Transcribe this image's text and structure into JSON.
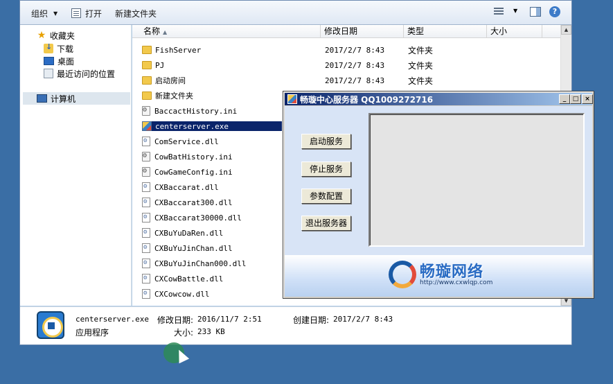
{
  "toolbar": {
    "organize": "组织",
    "open": "打开",
    "new_folder": "新建文件夹"
  },
  "nav": {
    "favorites": "收藏夹",
    "downloads": "下载",
    "desktop": "桌面",
    "recent": "最近访问的位置",
    "computer": "计算机"
  },
  "columns": {
    "name": "名称",
    "modified": "修改日期",
    "type": "类型",
    "size": "大小"
  },
  "files": [
    {
      "name": "FishServer",
      "date": "2017/2/7 8:43",
      "type": "文件夹",
      "icon": "folder-icon"
    },
    {
      "name": "PJ",
      "date": "2017/2/7 8:43",
      "type": "文件夹",
      "icon": "folder-icon"
    },
    {
      "name": "启动房间",
      "date": "2017/2/7 8:43",
      "type": "文件夹",
      "icon": "folder-icon"
    },
    {
      "name": "新建文件夹",
      "date": "",
      "type": "",
      "icon": "folder-icon"
    },
    {
      "name": "BaccactHistory.ini",
      "date": "",
      "type": "",
      "icon": "ini-file-icon"
    },
    {
      "name": "centerserver.exe",
      "date": "",
      "type": "",
      "icon": "exe-icon",
      "selected": true
    },
    {
      "name": "ComService.dll",
      "date": "",
      "type": "",
      "icon": "dll-file-icon"
    },
    {
      "name": "CowBatHistory.ini",
      "date": "",
      "type": "",
      "icon": "ini-file-icon"
    },
    {
      "name": "CowGameConfig.ini",
      "date": "",
      "type": "",
      "icon": "ini-file-icon"
    },
    {
      "name": "CXBaccarat.dll",
      "date": "",
      "type": "",
      "icon": "dll-file-icon"
    },
    {
      "name": "CXBaccarat300.dll",
      "date": "",
      "type": "",
      "icon": "dll-file-icon"
    },
    {
      "name": "CXBaccarat30000.dll",
      "date": "",
      "type": "",
      "icon": "dll-file-icon"
    },
    {
      "name": "CXBuYuDaRen.dll",
      "date": "",
      "type": "",
      "icon": "dll-file-icon"
    },
    {
      "name": "CXBuYuJinChan.dll",
      "date": "",
      "type": "",
      "icon": "dll-file-icon"
    },
    {
      "name": "CXBuYuJinChan000.dll",
      "date": "",
      "type": "",
      "icon": "dll-file-icon"
    },
    {
      "name": "CXCowBattle.dll",
      "date": "",
      "type": "",
      "icon": "dll-file-icon"
    },
    {
      "name": "CXCowcow.dll",
      "date": "",
      "type": "",
      "icon": "dll-file-icon"
    }
  ],
  "details": {
    "filename": "centerserver.exe",
    "modified_label": "修改日期:",
    "modified_value": "2016/11/7 2:51",
    "created_label": "创建日期:",
    "created_value": "2017/2/7 8:43",
    "type": "应用程序",
    "size_label": "大小:",
    "size_value": "233 KB"
  },
  "dialog": {
    "title": "畅璇中心服务器 QQ1009272716",
    "buttons": {
      "start": "启动服务",
      "stop": "停止服务",
      "config": "参数配置",
      "exit": "退出服务器"
    },
    "logo_text": "畅璇网络",
    "logo_url": "http://www.cxwlqp.com"
  },
  "colors": {
    "desktop": "#3a6ea5",
    "selection": "#0a246a",
    "dialog_title": "#0a246a"
  }
}
